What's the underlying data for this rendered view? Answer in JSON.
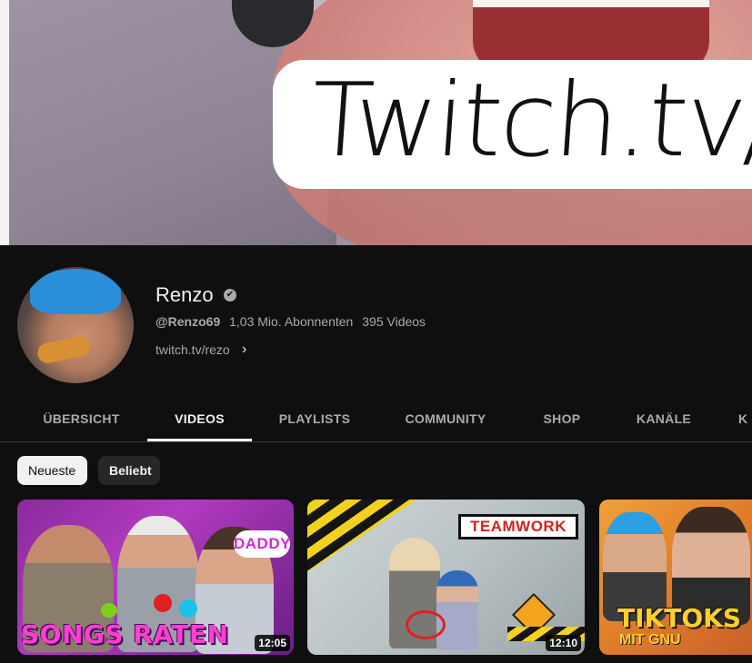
{
  "banner": {
    "text": "Twitch.tv/R"
  },
  "channel": {
    "name": "Renzo",
    "handle": "@Renzo69",
    "subscribers": "1,03 Mio. Abonnenten",
    "video_count": "395 Videos",
    "link": "twitch.tv/rezo",
    "verified_icon": "✔"
  },
  "tabs": [
    {
      "label": "ÜBERSICHT",
      "active": false
    },
    {
      "label": "VIDEOS",
      "active": true
    },
    {
      "label": "PLAYLISTS",
      "active": false
    },
    {
      "label": "COMMUNITY",
      "active": false
    },
    {
      "label": "SHOP",
      "active": false
    },
    {
      "label": "KANÄLE",
      "active": false
    },
    {
      "label": "K",
      "active": false
    }
  ],
  "filters": [
    {
      "label": "Neueste",
      "selected": true
    },
    {
      "label": "Beliebt",
      "selected": false
    }
  ],
  "videos": [
    {
      "thumb_text": "SONGS RATEN",
      "badge": "DADDY",
      "duration": "12:05"
    },
    {
      "thumb_text": "TEAMWORK",
      "duration": "12:10"
    },
    {
      "thumb_text": "TIKTOKS",
      "thumb_subtext": "MIT GNU"
    }
  ],
  "colors": {
    "background": "#0f0f0f",
    "text_primary": "#f1f1f1",
    "text_secondary": "#aaaaaa",
    "chip_selected_bg": "#f1f1f1",
    "chip_bg": "#272727"
  }
}
